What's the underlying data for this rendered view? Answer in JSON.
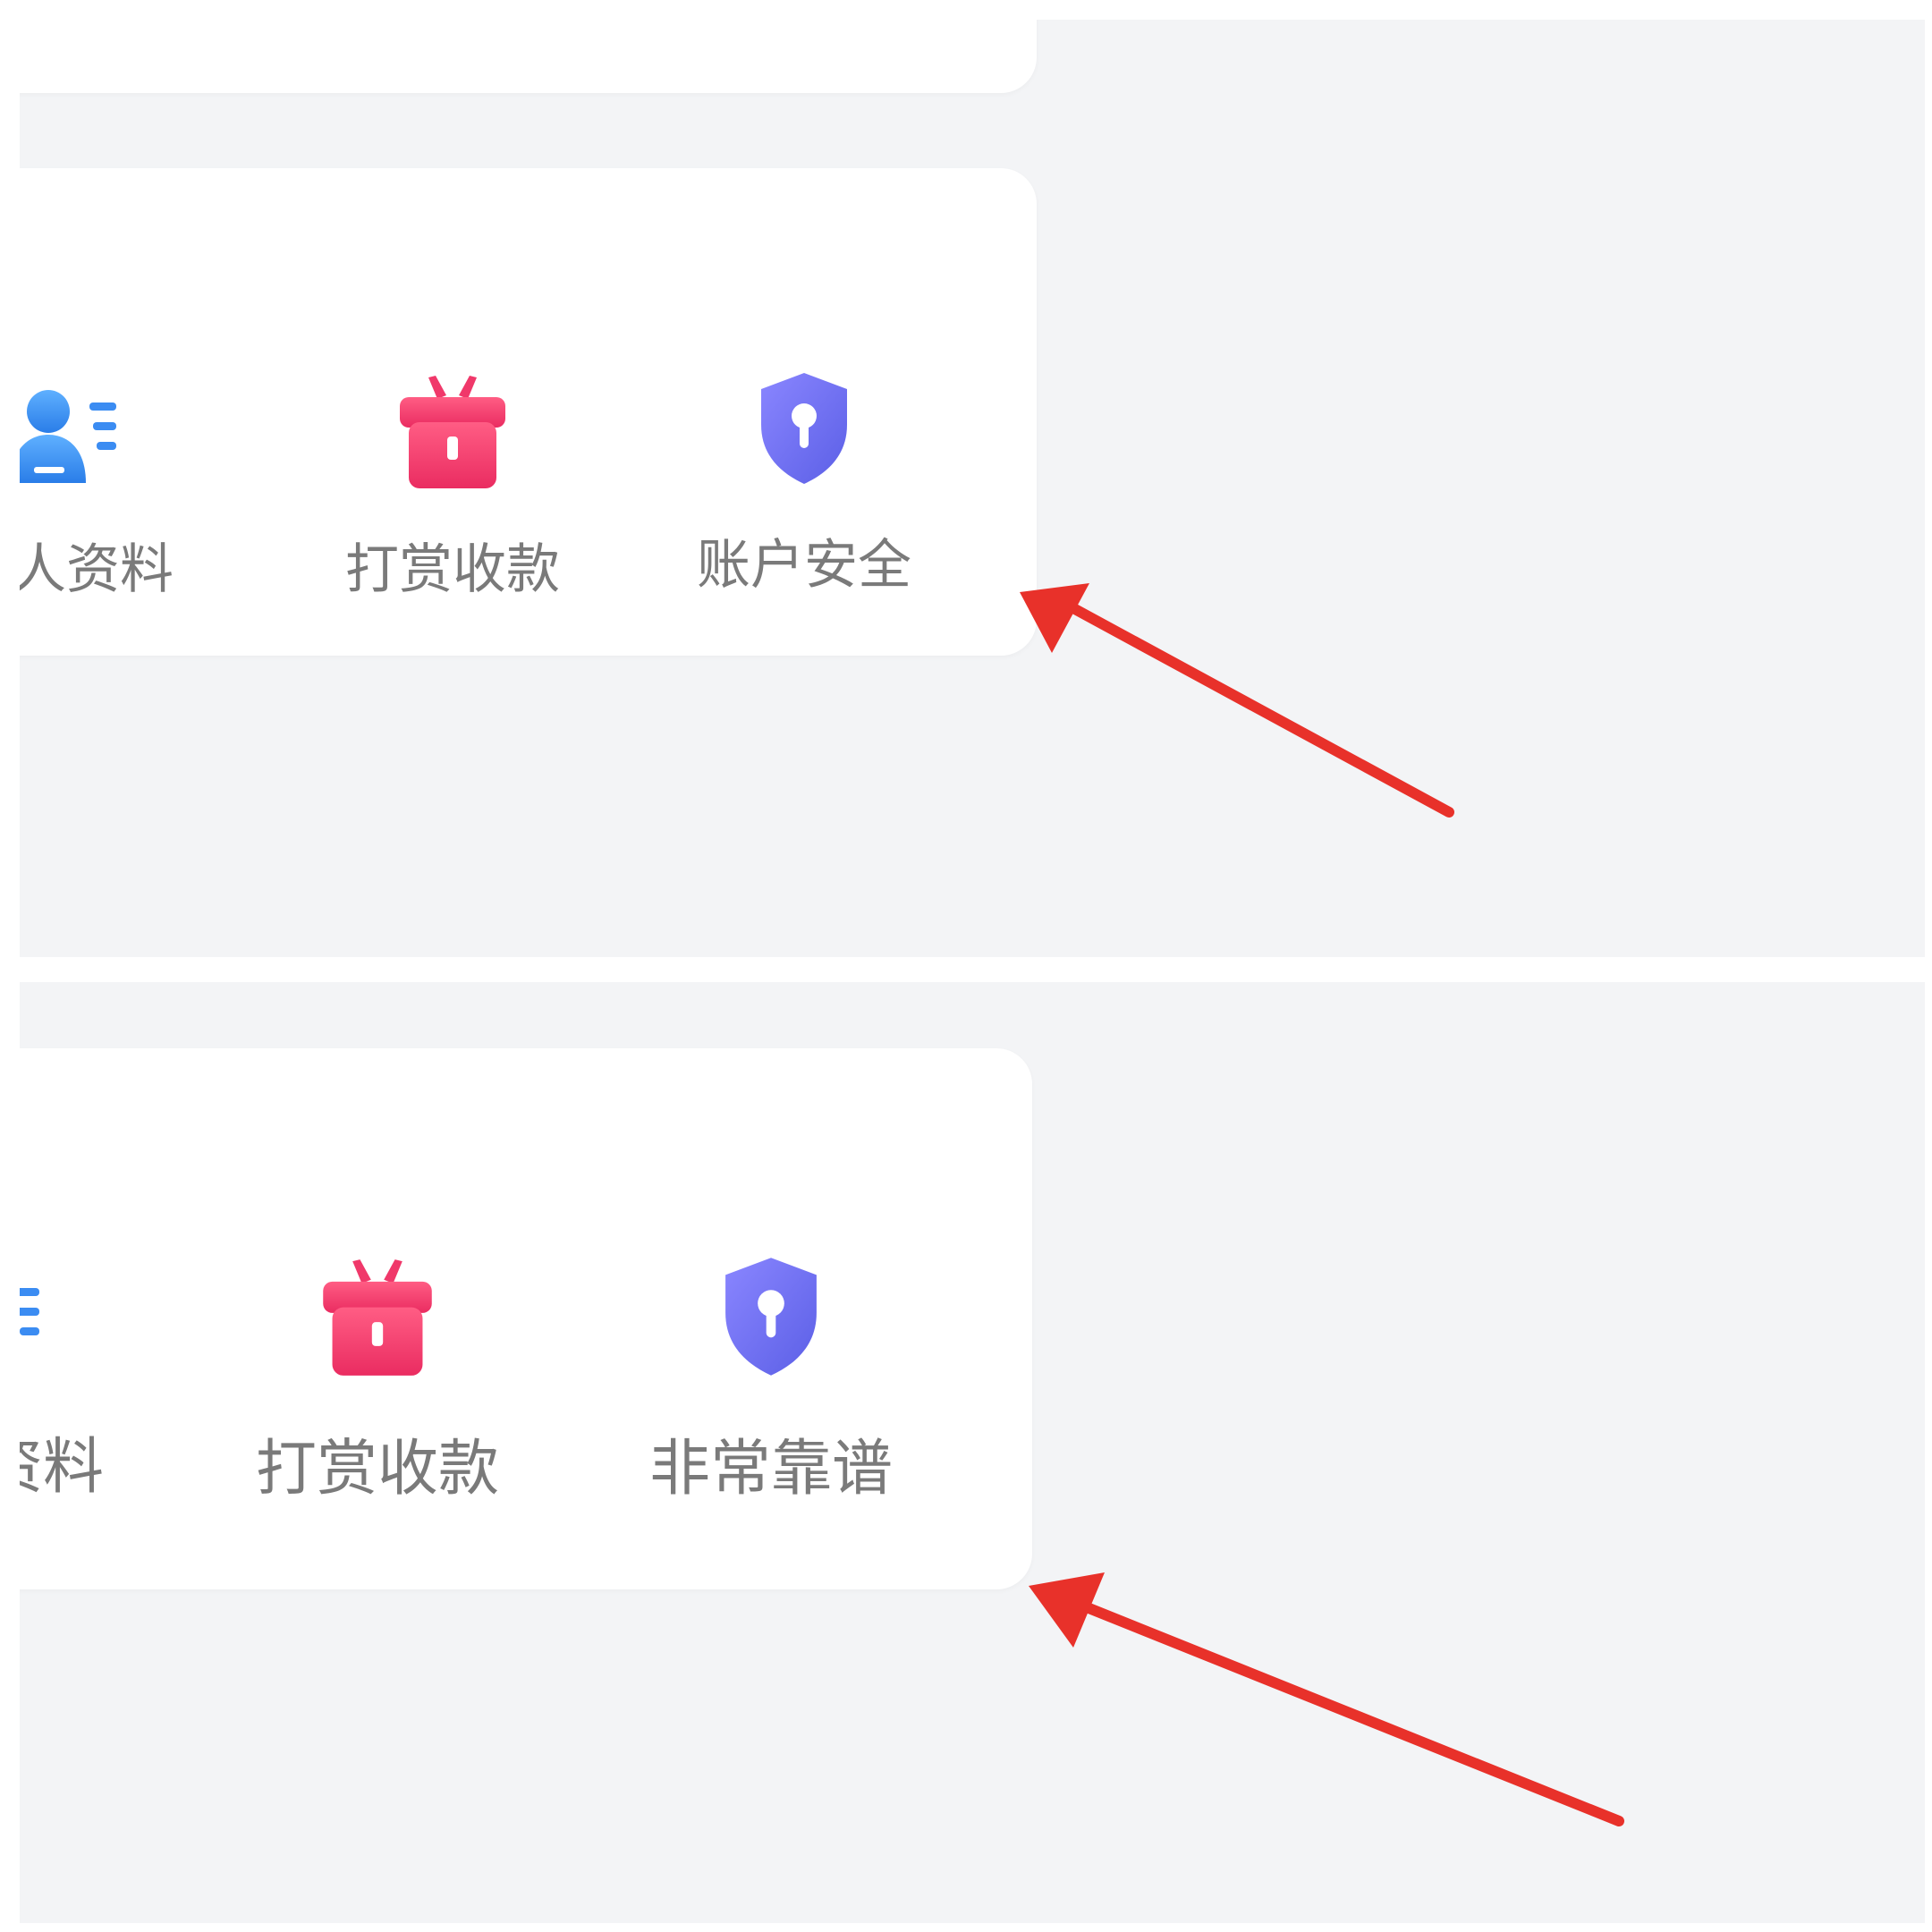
{
  "screens": [
    {
      "menu": [
        {
          "label": "个人资料",
          "icon": "user-profile-icon",
          "color": "#3b8cf2"
        },
        {
          "label": "打赏收款",
          "icon": "gift-icon",
          "color": "#f0386a"
        },
        {
          "label": "账户安全",
          "icon": "shield-lock-icon",
          "color": "#6e6ff0"
        }
      ]
    },
    {
      "menu": [
        {
          "label": "资料",
          "icon": "user-profile-icon",
          "color": "#3b8cf2"
        },
        {
          "label": "打赏收款",
          "icon": "gift-icon",
          "color": "#f0386a"
        },
        {
          "label": "非常靠谱",
          "icon": "shield-lock-icon",
          "color": "#6e6ff0"
        }
      ]
    }
  ],
  "colors": {
    "background": "#f3f4f6",
    "card": "#ffffff",
    "label_text": "#7a7a7a",
    "annotation_arrow": "#e8312a"
  }
}
